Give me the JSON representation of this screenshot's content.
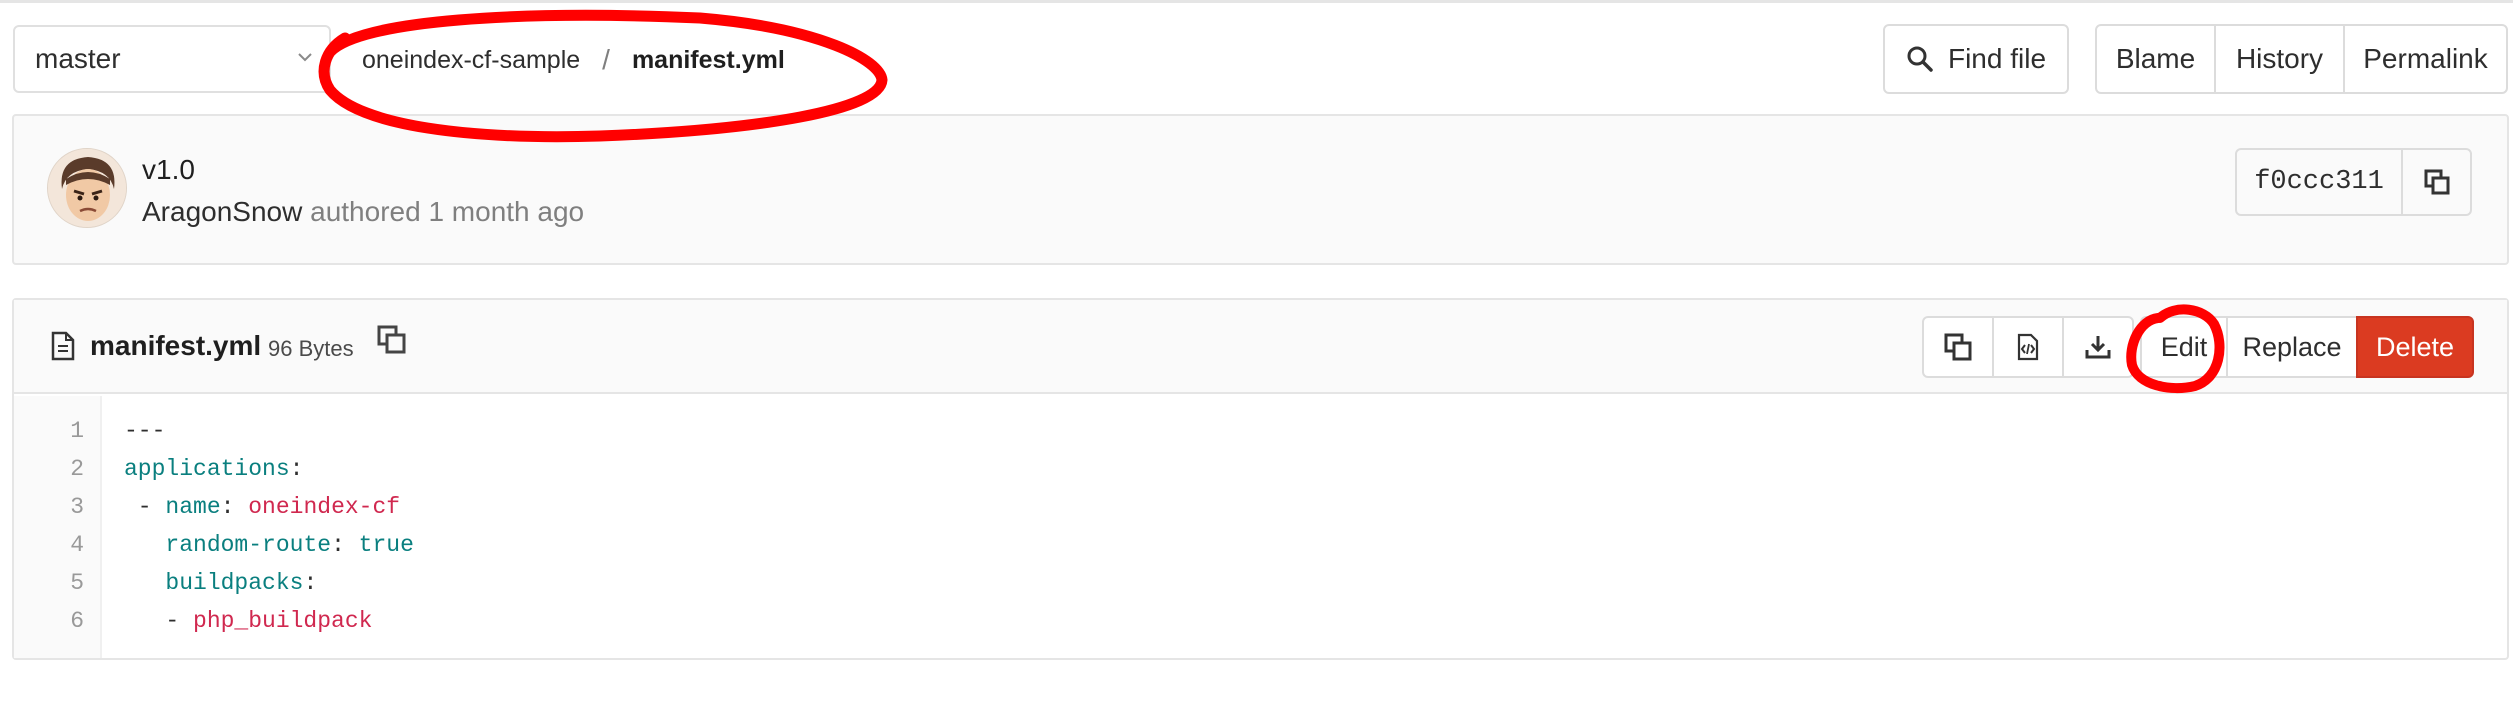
{
  "branch": {
    "name": "master"
  },
  "breadcrumb": {
    "project": "oneindex-cf-sample",
    "separator": "/",
    "file": "manifest.yml"
  },
  "top_actions": {
    "find_file": "Find file",
    "blame": "Blame",
    "history": "History",
    "permalink": "Permalink"
  },
  "commit": {
    "title": "v1.0",
    "author": "AragonSnow",
    "verb": "authored",
    "time": "1 month ago",
    "sha": "f0ccc311"
  },
  "file": {
    "name": "manifest.yml",
    "size": "96 Bytes",
    "actions": {
      "edit": "Edit",
      "replace": "Replace",
      "delete": "Delete"
    }
  },
  "code": {
    "lines": [
      {
        "n": "1",
        "parts": [
          {
            "t": "---",
            "c": "plain"
          }
        ]
      },
      {
        "n": "2",
        "parts": [
          {
            "t": "applications",
            "c": "k"
          },
          {
            "t": ":",
            "c": "plain"
          }
        ]
      },
      {
        "n": "3",
        "parts": [
          {
            "t": " - ",
            "c": "plain"
          },
          {
            "t": "name",
            "c": "k"
          },
          {
            "t": ": ",
            "c": "plain"
          },
          {
            "t": "oneindex-cf",
            "c": "s"
          }
        ]
      },
      {
        "n": "4",
        "parts": [
          {
            "t": "   ",
            "c": "plain"
          },
          {
            "t": "random-route",
            "c": "k"
          },
          {
            "t": ": ",
            "c": "plain"
          },
          {
            "t": "true",
            "c": "b"
          }
        ]
      },
      {
        "n": "5",
        "parts": [
          {
            "t": "   ",
            "c": "plain"
          },
          {
            "t": "buildpacks",
            "c": "k"
          },
          {
            "t": ":",
            "c": "plain"
          }
        ]
      },
      {
        "n": "6",
        "parts": [
          {
            "t": "   - ",
            "c": "plain"
          },
          {
            "t": "php_buildpack",
            "c": "s"
          }
        ]
      }
    ]
  },
  "colors": {
    "delete": "#db3b21",
    "key": "#0a7f7f",
    "string": "#d0284f",
    "annotation": "#ff0000"
  },
  "icons": [
    "chevron-down-icon",
    "search-icon",
    "copy-icon",
    "file-icon",
    "raw-file-icon",
    "download-icon"
  ]
}
